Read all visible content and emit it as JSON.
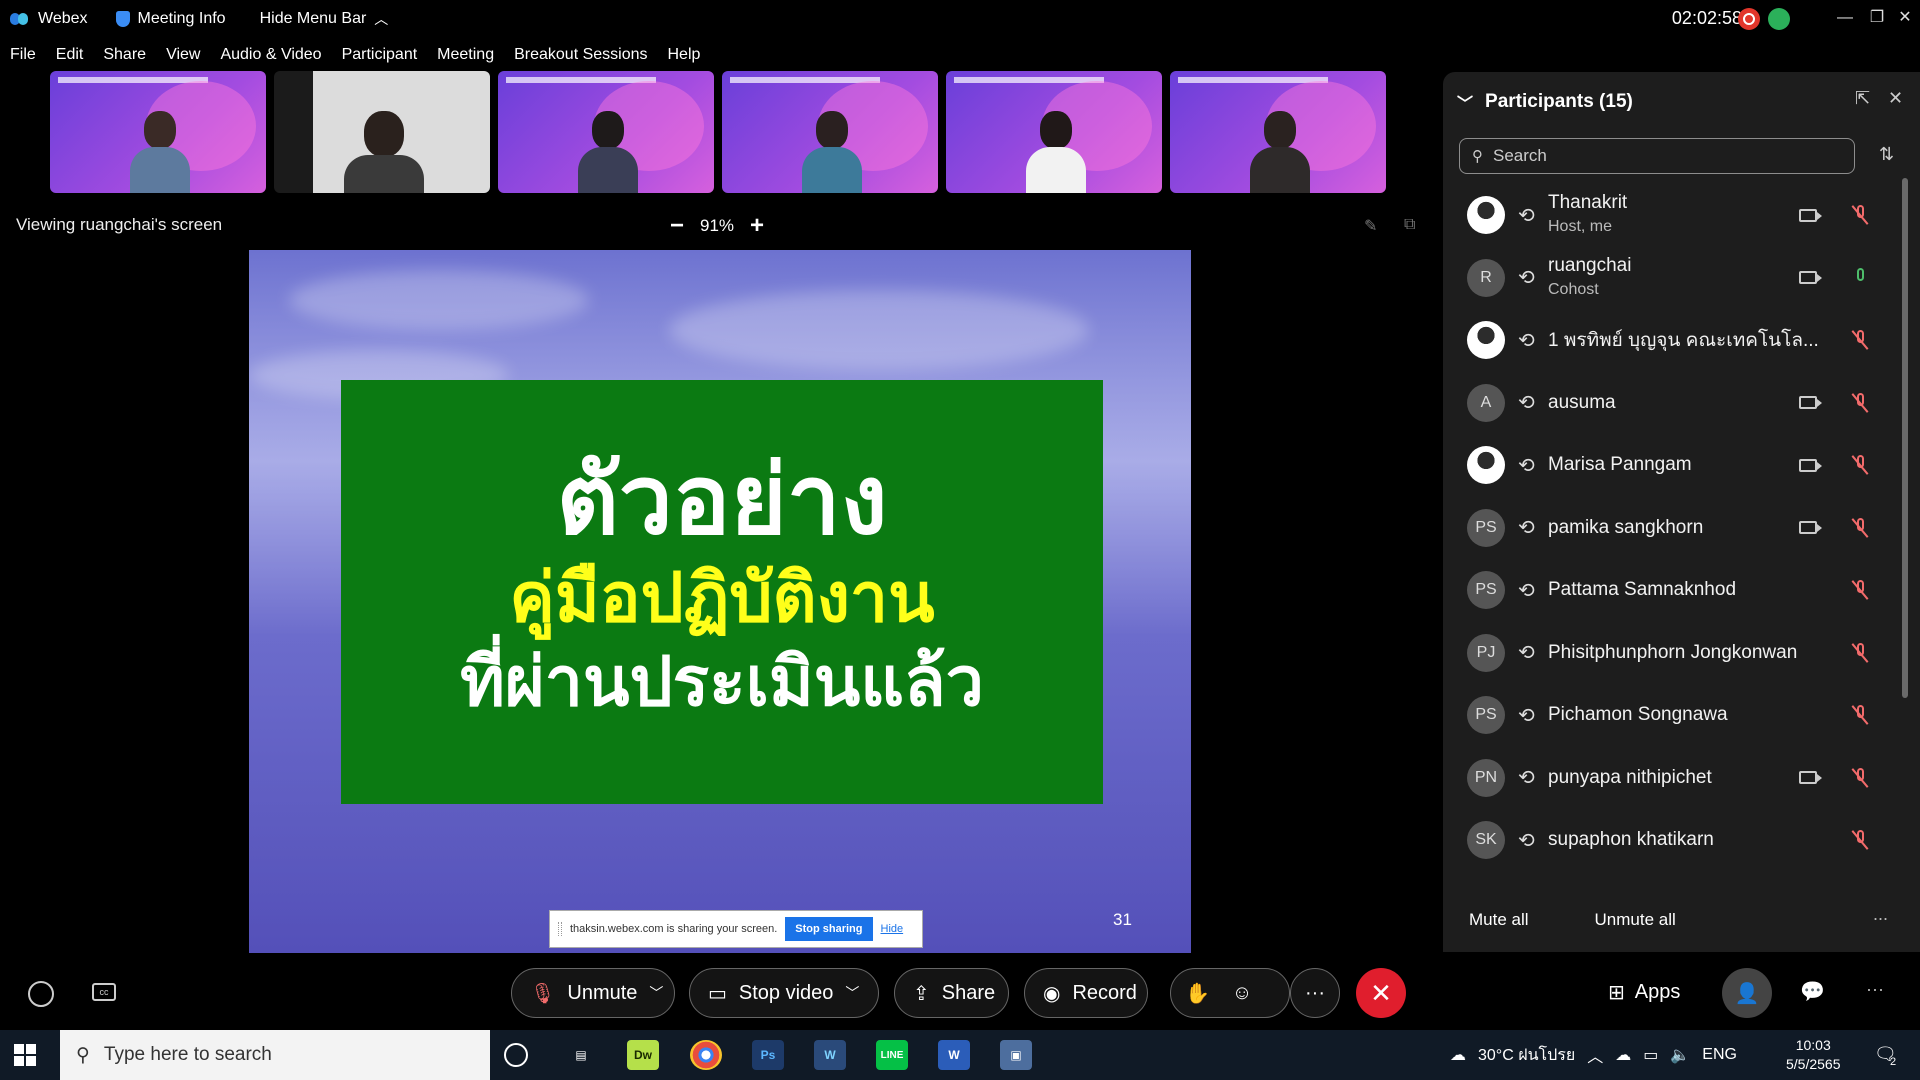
{
  "titlebar": {
    "app_name": "Webex",
    "meeting_info": "Meeting Info",
    "hide_menu_bar": "Hide Menu Bar",
    "clock": "02:02:58"
  },
  "menu": [
    "File",
    "Edit",
    "Share",
    "View",
    "Audio & Video",
    "Participant",
    "Meeting",
    "Breakout Sessions",
    "Help"
  ],
  "view": {
    "viewing_label": "Viewing ruangchai's screen",
    "zoom": "91%",
    "zoom_out": "−",
    "zoom_in": "+"
  },
  "slide": {
    "line1": "ตัวอย่าง",
    "line2": "คู่มือปฏิบัติงาน",
    "line3": "ที่ผ่านประเมินแล้ว",
    "page": "31",
    "share_notice": "thaksin.webex.com is sharing your screen.",
    "stop_sharing": "Stop sharing",
    "hide": "Hide"
  },
  "participants": {
    "title": "Participants (15)",
    "search_placeholder": "Search",
    "mute_all": "Mute all",
    "unmute_all": "Unmute all",
    "more": "...",
    "list": [
      {
        "initials": "",
        "name": "Thanakrit",
        "role": "Host, me",
        "camera": true,
        "mic": "off"
      },
      {
        "initials": "R",
        "name": "ruangchai",
        "role": "Cohost",
        "camera": true,
        "mic": "on"
      },
      {
        "initials": "",
        "name": "1 พรทิพย์ บุญจุน คณะเทคโนโล...",
        "role": "",
        "camera": false,
        "mic": "off"
      },
      {
        "initials": "A",
        "name": "ausuma",
        "role": "",
        "camera": true,
        "mic": "off"
      },
      {
        "initials": "",
        "name": "Marisa Panngam",
        "role": "",
        "camera": true,
        "mic": "off"
      },
      {
        "initials": "PS",
        "name": "pamika sangkhorn",
        "role": "",
        "camera": true,
        "mic": "off"
      },
      {
        "initials": "PS",
        "name": "Pattama Samnaknhod",
        "role": "",
        "camera": false,
        "mic": "off"
      },
      {
        "initials": "PJ",
        "name": "Phisitphunphorn Jongkonwan",
        "role": "",
        "camera": false,
        "mic": "off"
      },
      {
        "initials": "PS",
        "name": "Pichamon Songnawa",
        "role": "",
        "camera": false,
        "mic": "off"
      },
      {
        "initials": "PN",
        "name": "punyapa nithipichet",
        "role": "",
        "camera": true,
        "mic": "off"
      },
      {
        "initials": "SK",
        "name": "supaphon khatikarn",
        "role": "",
        "camera": false,
        "mic": "off"
      }
    ]
  },
  "controls": {
    "unmute": "Unmute",
    "stop_video": "Stop video",
    "share": "Share",
    "record": "Record",
    "apps": "Apps",
    "more": "···"
  },
  "taskbar": {
    "search_placeholder": "Type here to search",
    "weather": "30°C ฝนโปรย",
    "lang": "ENG",
    "time": "10:03",
    "date": "5/5/2565",
    "notifications": "2"
  },
  "colors": {
    "slide_green": "#0b7a12",
    "slide_yellow": "#ffff1a",
    "end_red": "#e01e2d",
    "mic_off": "#f26b6b",
    "mic_on": "#4dbd6a"
  }
}
